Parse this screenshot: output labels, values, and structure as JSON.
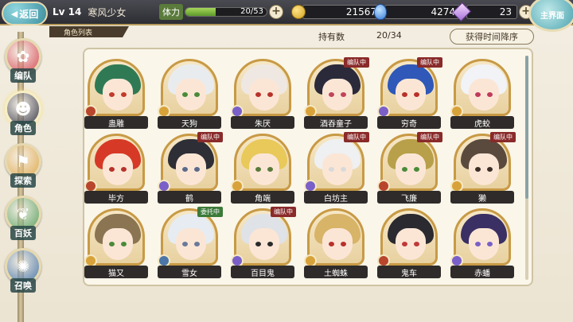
{
  "header": {
    "back_label": "返回",
    "level": "Lv 14",
    "player_name": "寒风少女",
    "stamina_label": "体力",
    "stamina_current": 20,
    "stamina_max": 53,
    "stamina_text": "20/53",
    "coins": "21567",
    "jade": "4274",
    "gems": "23",
    "main_label": "主界面"
  },
  "sidebar": {
    "items": [
      {
        "label": "编队",
        "icon": "formation-icon",
        "color": "#d64a54",
        "glyph": "✿"
      },
      {
        "label": "角色",
        "icon": "character-icon",
        "color": "#3a3a48",
        "glyph": "☻"
      },
      {
        "label": "探索",
        "icon": "explore-icon",
        "color": "#e0a84c",
        "glyph": "⚑"
      },
      {
        "label": "百妖",
        "icon": "yokai-book-icon",
        "color": "#5aa060",
        "glyph": "❦"
      },
      {
        "label": "召唤",
        "icon": "summon-icon",
        "color": "#4a76a8",
        "glyph": "✺"
      }
    ],
    "active_index": 1
  },
  "list": {
    "title": "角色列表",
    "owned_label": "持有数",
    "owned_count": "20/34",
    "sort_label": "获得时间降序"
  },
  "status_labels": {
    "party": "编队中",
    "commission": "委托中"
  },
  "characters": [
    {
      "name": "蛊雕",
      "status": "",
      "hair": "#2f7a55",
      "eye": "#c23b2b",
      "elem": "#b8462c"
    },
    {
      "name": "天狗",
      "status": "",
      "hair": "#e9ecef",
      "eye": "#4a8a3a",
      "elem": "#d8a23a"
    },
    {
      "name": "朱厌",
      "status": "",
      "hair": "#efe8e2",
      "eye": "#b8322a",
      "elem": "#7a5fc8"
    },
    {
      "name": "酒吞童子",
      "status": "party",
      "hair": "#2b2a3a",
      "eye": "#c0455a",
      "elem": "#d8a23a"
    },
    {
      "name": "穷奇",
      "status": "party",
      "hair": "#2f58b8",
      "eye": "#b8322a",
      "elem": "#7a5fc8"
    },
    {
      "name": "虎蛟",
      "status": "",
      "hair": "#f2f3f6",
      "eye": "#c03a5a",
      "elem": "#d8a23a"
    },
    {
      "name": "毕方",
      "status": "",
      "hair": "#d63a26",
      "eye": "#b8322a",
      "elem": "#b8462c"
    },
    {
      "name": "鹤",
      "status": "party",
      "hair": "#2e2e36",
      "eye": "#5a6a8a",
      "elem": "#7a5fc8"
    },
    {
      "name": "角端",
      "status": "",
      "hair": "#e8c95a",
      "eye": "#5a7a3a",
      "elem": "#d8a23a"
    },
    {
      "name": "白坊主",
      "status": "party",
      "hair": "#eef0f2",
      "eye": "#d9d9d9",
      "elem": "#7a5fc8"
    },
    {
      "name": "飞廉",
      "status": "party",
      "hair": "#b8a04a",
      "eye": "#4a8a3a",
      "elem": "#b8462c"
    },
    {
      "name": "獭",
      "status": "party",
      "hair": "#5a4a3e",
      "eye": "#3a2e26",
      "elem": "#d8a23a"
    },
    {
      "name": "猫又",
      "status": "",
      "hair": "#8a7452",
      "eye": "#4a8a3a",
      "elem": "#d8a23a"
    },
    {
      "name": "雪女",
      "status": "commission",
      "hair": "#e6ecf2",
      "eye": "#6a7a9a",
      "elem": "#4a76a8"
    },
    {
      "name": "百目鬼",
      "status": "party",
      "hair": "#dfe2e6",
      "eye": "#2a2a2a",
      "elem": "#7a5fc8"
    },
    {
      "name": "土蜘蛛",
      "status": "",
      "hair": "#d8b468",
      "eye": "#b8322a",
      "elem": "#d8a23a"
    },
    {
      "name": "鬼车",
      "status": "",
      "hair": "#2a2a30",
      "eye": "#c03a3a",
      "elem": "#b8462c"
    },
    {
      "name": "赤蟠",
      "status": "",
      "hair": "#3a3064",
      "eye": "#7a5fc8",
      "elem": "#7a5fc8"
    }
  ]
}
